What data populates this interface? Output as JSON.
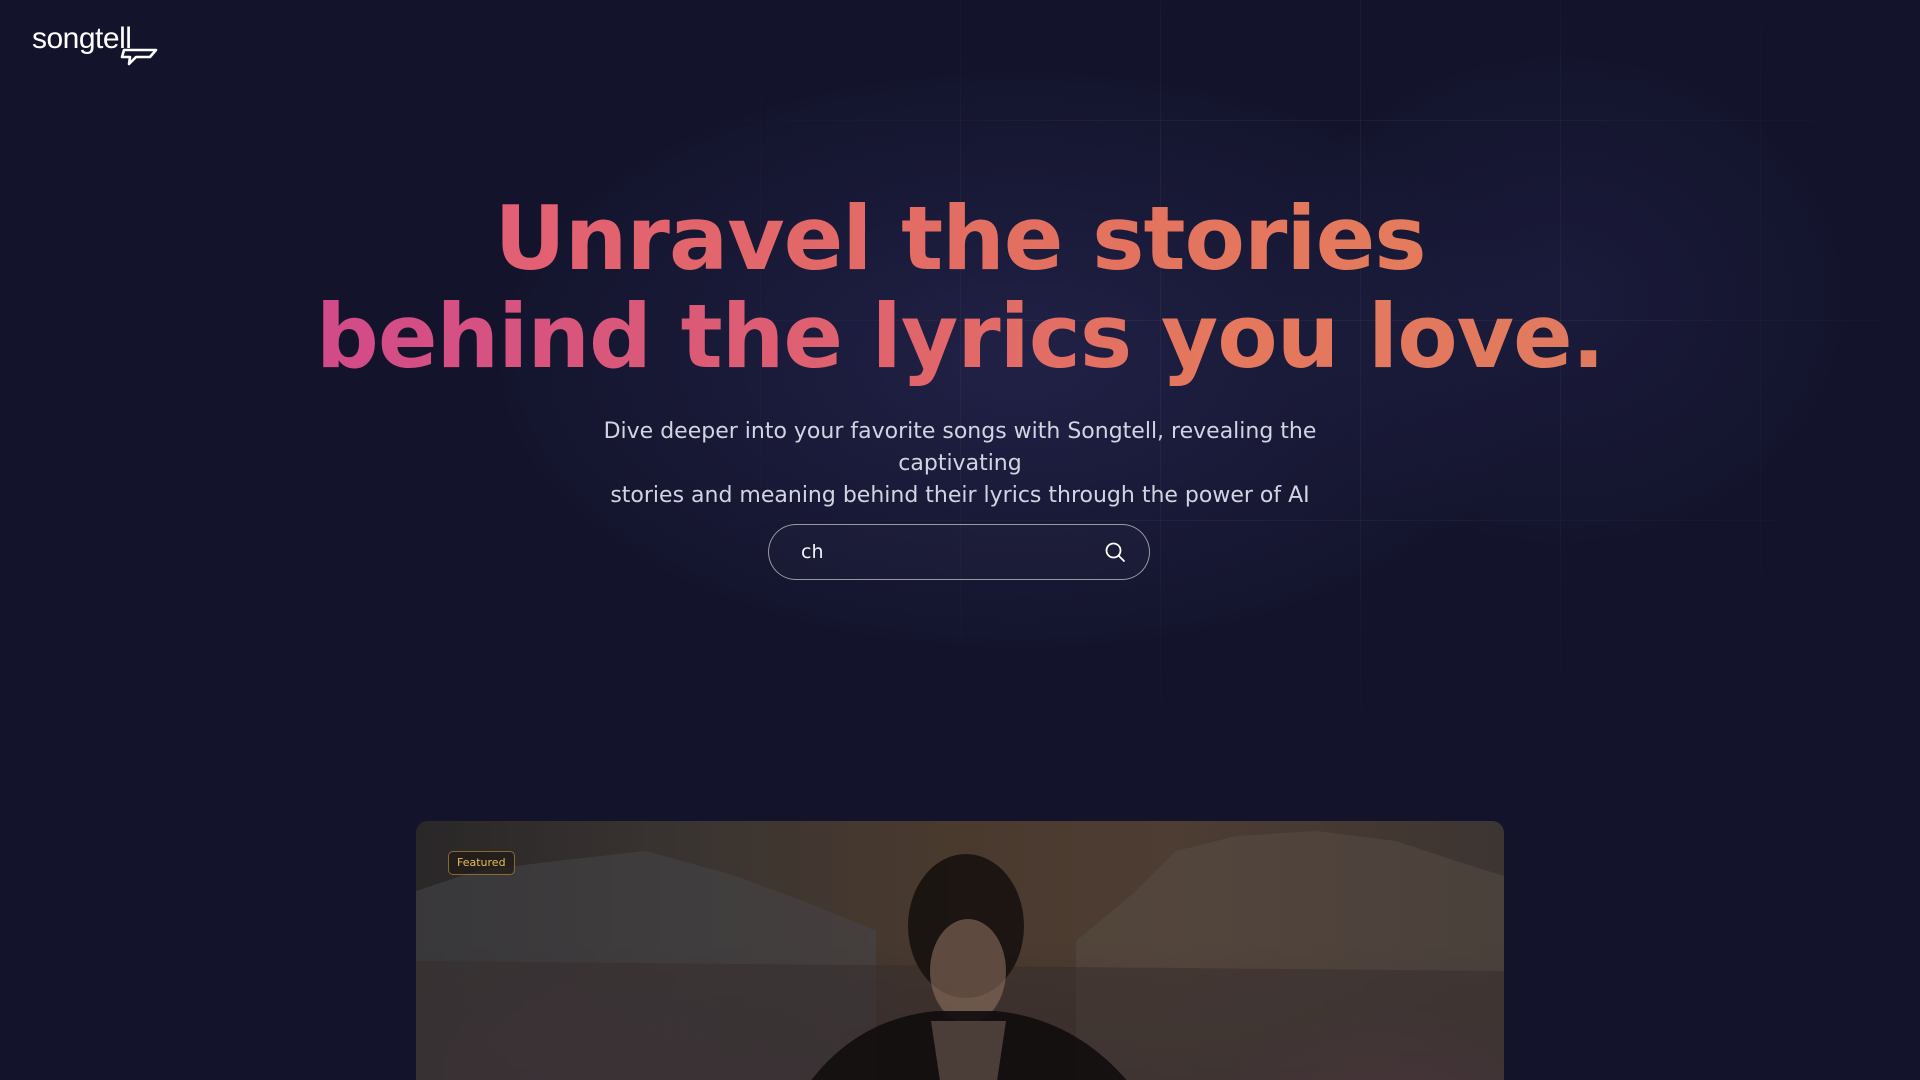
{
  "brand": {
    "name": "songtell"
  },
  "hero": {
    "headline_line1": "Unravel the stories",
    "headline_line2": "behind the lyrics you love.",
    "subtitle_line1": "Dive deeper into your favorite songs with Songtell, revealing the captivating",
    "subtitle_line2": "stories and meaning behind their lyrics through the power of AI"
  },
  "search": {
    "value": "ch",
    "icon": "search-icon"
  },
  "featured": {
    "badge": "Featured"
  },
  "colors": {
    "background": "#13142c",
    "headline_start": "#d24a8a",
    "headline_end": "#e47c5c",
    "badge_text": "#e6bd5a"
  }
}
